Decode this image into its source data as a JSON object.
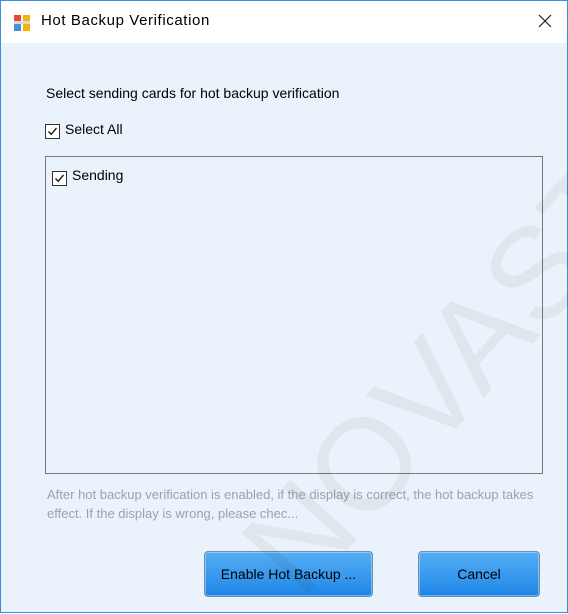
{
  "window": {
    "title": "Hot Backup Verification",
    "close_glyph": "×",
    "app_icon": "app-window-icon"
  },
  "instruction": "Select sending cards for hot backup verification",
  "select_all": {
    "label": "Select All",
    "checked": true
  },
  "cards": [
    {
      "label": "Sending",
      "checked": true
    }
  ],
  "note": "After hot backup verification is enabled, if the display is correct, the hot backup takes effect. If the display is wrong, please chec...",
  "buttons": {
    "enable": "Enable Hot Backup ...",
    "cancel": "Cancel"
  },
  "colors": {
    "client_bg": "#eaf3fb",
    "button_top": "#55aef4",
    "button_bottom": "#1f86e6",
    "note_text": "#9aa3ab"
  },
  "watermark": "NOVASTAR"
}
